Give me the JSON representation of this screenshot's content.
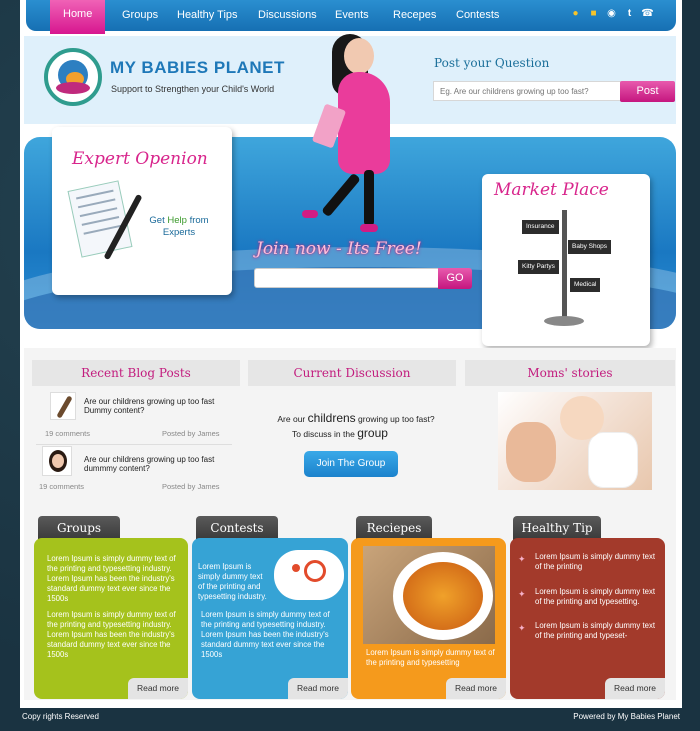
{
  "nav": {
    "items": [
      "Home",
      "Groups",
      "Healthy Tips",
      "Discussions",
      "Events",
      "Recepes",
      "Contests"
    ],
    "icons": [
      "location-icon",
      "lock-icon",
      "user-icon",
      "twitter-icon",
      "phone-icon"
    ]
  },
  "header": {
    "logo_title": "MY BABIES PLANET",
    "logo_subtitle": "Support to Strengthen your Child's World",
    "question_title": "Post your Question",
    "question_placeholder": "Eg. Are our childrens growing up too fast?",
    "post_label": "Post"
  },
  "hero": {
    "expert_title": "Expert Openion",
    "expert_help_1": "Get",
    "expert_help_bold": "Help",
    "expert_help_2": "from Experts",
    "join_title": "Join now - Its Free!",
    "go_label": "GO",
    "market_title": "Market Place",
    "signs": [
      "Insurance",
      "Baby Shops",
      "Kitty Partys",
      "Medical"
    ]
  },
  "sections": {
    "blog_title": "Recent Blog Posts",
    "discussion_title": "Current Discussion",
    "moms_title": "Moms' stories"
  },
  "blog": {
    "posts": [
      {
        "title": "Are our childrens growing up too fast Dummy content?",
        "comments": "19 comments",
        "author": "Posted by James"
      },
      {
        "title": "Are our childrens growing up too fast dummmy content?",
        "comments": "19 comments",
        "author": "Posted by James"
      }
    ]
  },
  "discussion": {
    "line1_a": "Are our",
    "line1_b": "childrens",
    "line1_c": "growing up too fast?",
    "line2_a": "To discuss in the",
    "line2_b": "group",
    "join_button": "Join The Group"
  },
  "cards": {
    "groups": {
      "title": "Groups",
      "p1": "Lorem Ipsum is simply dummy text of the printing and typesetting industry. Lorem Ipsum has been the industry's standard dummy text ever since the 1500s",
      "p2": "Lorem Ipsum is simply dummy text of the printing and typesetting industry. Lorem Ipsum has been the industry's standard dummy text ever since the 1500s",
      "read_more": "Read more",
      "color": "#a5c21c"
    },
    "contests": {
      "title": "Contests",
      "p1": "Lorem Ipsum is simply dummy text of the printing and typesetting industry.",
      "p2": "Lorem Ipsum is simply dummy text of the printing and typesetting industry. Lorem Ipsum has been the industry's standard dummy text ever since the 1500s",
      "read_more": "Read more",
      "color": "#36a3d5"
    },
    "recipes": {
      "title": "Reciepes",
      "p1": "Lorem Ipsum is simply dummy text of the printing and typesetting",
      "read_more": "Read more",
      "color": "#f59a1c"
    },
    "healthy": {
      "title": "Healthy Tip",
      "tips": [
        "Lorem Ipsum is simply dummy text of the printing",
        "Lorem Ipsum is simply dummy text of the printing and typesetting.",
        "Lorem Ipsum is simply dummy text of the printing and typeset-"
      ],
      "read_more": "Read more",
      "color": "#a33a2b"
    }
  },
  "footer": {
    "left": "Copy rights Reserved",
    "right": "Powered by My Babies Planet"
  }
}
